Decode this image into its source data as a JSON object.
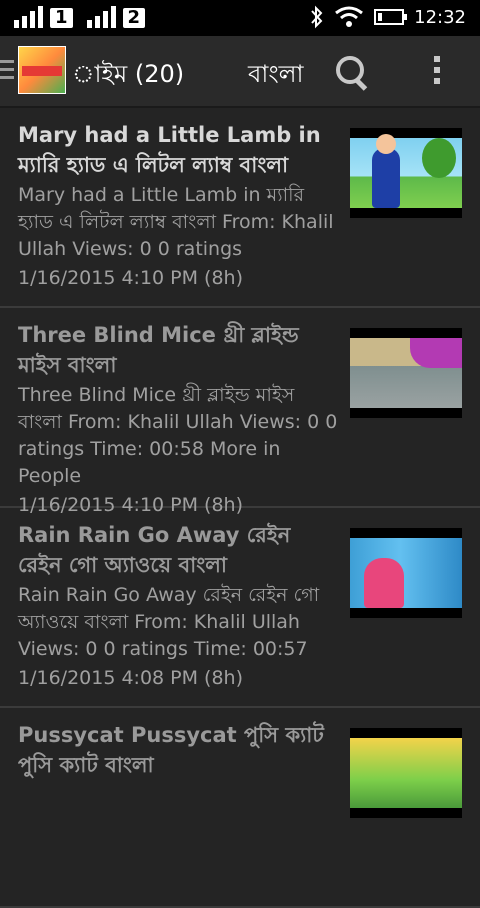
{
  "status_bar": {
    "sim1": "1",
    "sim2": "2",
    "time": "12:32"
  },
  "action_bar": {
    "title": "াইম (20)",
    "language": "বাংলা",
    "icons": [
      "menu-icon",
      "app-logo",
      "search-icon",
      "overflow-menu-icon"
    ]
  },
  "items": [
    {
      "title": "Mary had a Little Lamb in ম্যারি হ্যাড এ লিটল ল্যাম্ব বাংলা",
      "description": "Mary had a Little Lamb in ম্যারি হ্যাড এ লিটল ল্যাম্ব বাংলা From: Khalil Ullah Views: 0 0 ratings",
      "timestamp": "1/16/2015 4:10 PM (8h)"
    },
    {
      "title": "Three Blind Mice থ্রী ব্লাইন্ড মাইস বাংলা",
      "description": "Three Blind Mice থ্রী ব্লাইন্ড মাইস বাংলা From: Khalil Ullah Views: 0 0 ratings Time: 00:58 More in People",
      "timestamp": "1/16/2015 4:10 PM (8h)"
    },
    {
      "title": "Rain Rain Go Away রেইন রেইন গো অ্যাওয়ে বাংলা",
      "description": "Rain Rain Go Away রেইন রেইন গো অ্যাওয়ে বাংলা From: Khalil Ullah Views: 0 0 ratings Time: 00:57",
      "timestamp": "1/16/2015 4:08 PM (8h)"
    },
    {
      "title": "Pussycat Pussycat পুসি ক্যাট পুসি ক্যাট বাংলা",
      "description": "",
      "timestamp": ""
    }
  ]
}
